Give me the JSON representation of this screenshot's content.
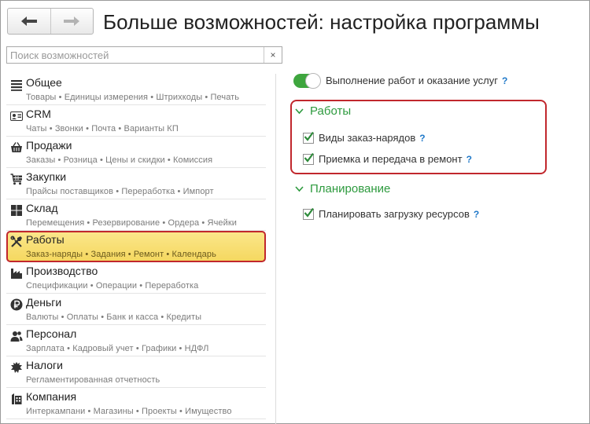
{
  "header": {
    "title": "Больше возможностей: настройка программы",
    "back_icon": "arrow-left-icon",
    "forward_icon": "arrow-right-icon"
  },
  "search": {
    "placeholder": "Поиск возможностей",
    "value": "",
    "clear_label": "×"
  },
  "sidebar": {
    "items": [
      {
        "icon": "list-icon",
        "label": "Общее",
        "sub": "Товары • Единицы измерения • Штрихкоды • Печать"
      },
      {
        "icon": "crm-card-icon",
        "label": "CRM",
        "sub": "Чаты • Звонки • Почта • Варианты КП"
      },
      {
        "icon": "basket-icon",
        "label": "Продажи",
        "sub": "Заказы • Розница • Цены и скидки • Комиссия"
      },
      {
        "icon": "cart-icon",
        "label": "Закупки",
        "sub": "Прайсы поставщиков • Переработка • Импорт"
      },
      {
        "icon": "warehouse-icon",
        "label": "Склад",
        "sub": "Перемещения • Резервирование • Ордера • Ячейки"
      },
      {
        "icon": "tools-icon",
        "label": "Работы",
        "sub": "Заказ-наряды • Задания • Ремонт • Календарь",
        "active": true
      },
      {
        "icon": "factory-icon",
        "label": "Производство",
        "sub": "Спецификации • Операции • Переработка"
      },
      {
        "icon": "ruble-icon",
        "label": "Деньги",
        "sub": "Валюты • Оплаты • Банк и касса • Кредиты"
      },
      {
        "icon": "people-icon",
        "label": "Персонал",
        "sub": "Зарплата • Кадровый учет • Графики • НДФЛ"
      },
      {
        "icon": "emblem-icon",
        "label": "Налоги",
        "sub": "Регламентированная отчетность"
      },
      {
        "icon": "company-icon",
        "label": "Компания",
        "sub": "Интеркампани • Магазины • Проекты • Имущество"
      }
    ]
  },
  "main": {
    "toggle": {
      "label": "Выполнение работ и оказание услуг",
      "on": true,
      "help": "?"
    },
    "sections": [
      {
        "title": "Работы",
        "options": [
          {
            "label": "Виды заказ-нарядов",
            "checked": true,
            "help": "?"
          },
          {
            "label": "Приемка и передача в ремонт",
            "checked": true,
            "help": "?"
          }
        ]
      },
      {
        "title": "Планирование",
        "options": [
          {
            "label": "Планировать загрузку ресурсов",
            "checked": true,
            "help": "?"
          }
        ]
      }
    ]
  },
  "colors": {
    "accent_green": "#2d9a3e",
    "toggle_on": "#3ea63e",
    "highlight_red": "#c1272d",
    "active_yellow": "#f5d860",
    "help_blue": "#2079c9"
  }
}
